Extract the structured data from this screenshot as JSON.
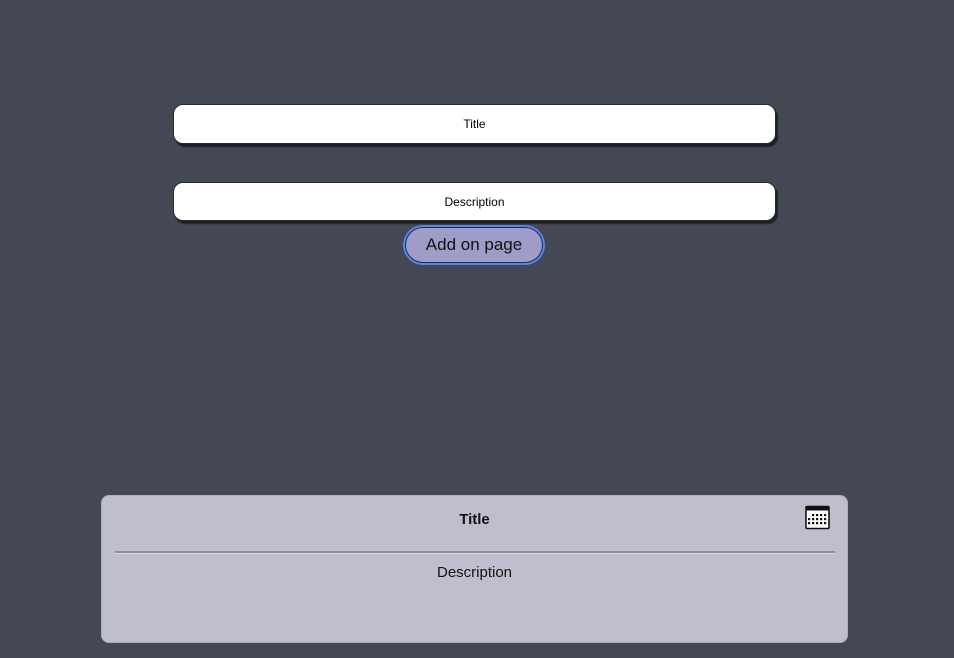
{
  "form": {
    "title_placeholder": "Title",
    "title_value": "",
    "description_placeholder": "Description",
    "description_value": "",
    "add_button_label": "Add on page"
  },
  "card": {
    "title": "Title",
    "description": "Description",
    "icon": "calendar-icon"
  },
  "colors": {
    "background": "#444854",
    "card_background": "#bfbece",
    "button_background": "#a09cc8",
    "focus_ring": "#4f86f7"
  }
}
